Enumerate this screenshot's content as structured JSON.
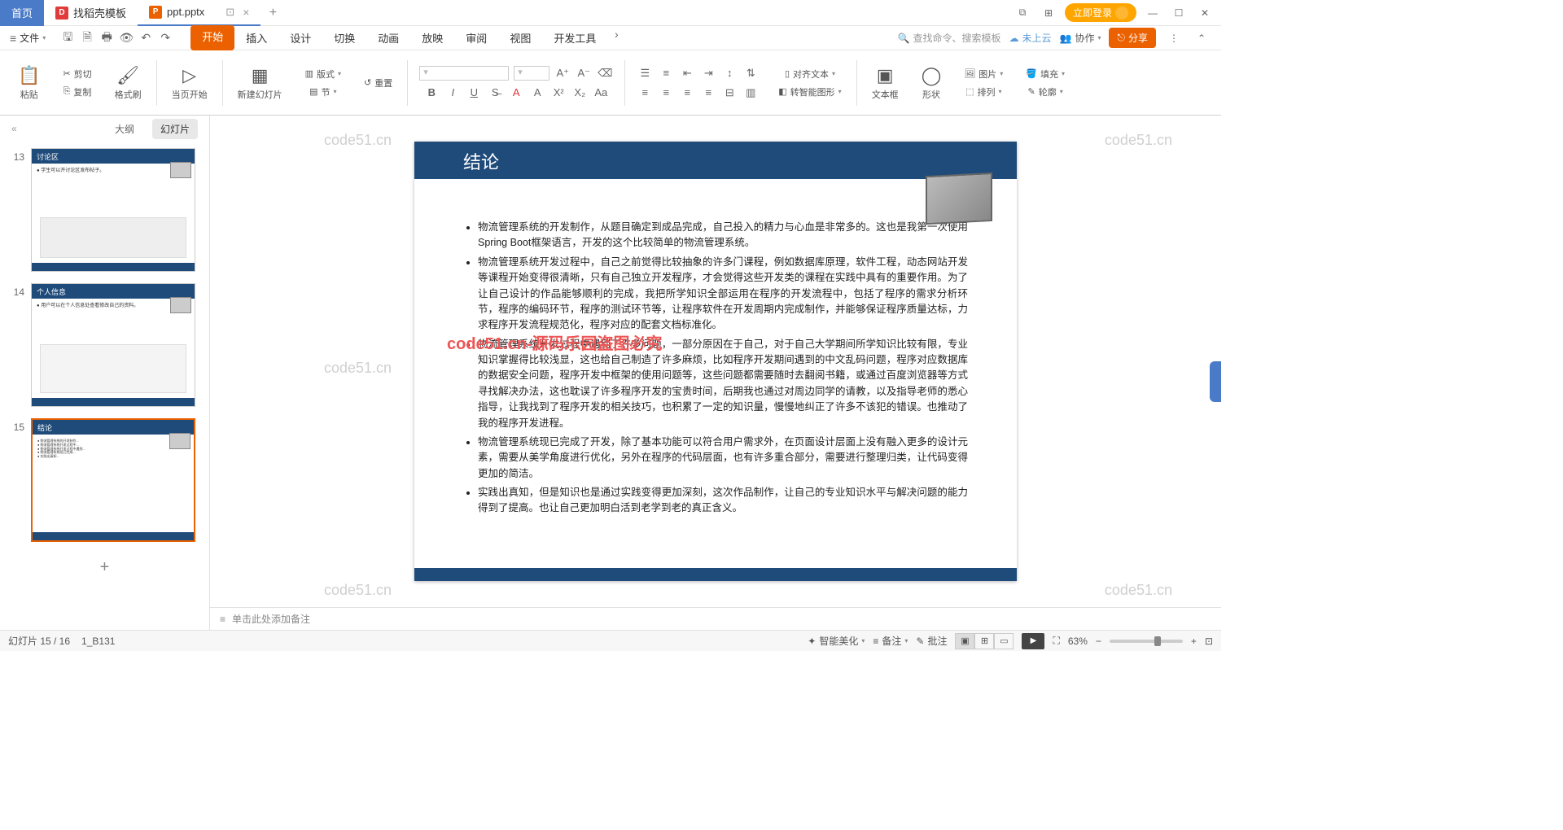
{
  "tabs": {
    "home": "首页",
    "t1": "找稻壳模板",
    "t2": "ppt.pptx"
  },
  "titlebar": {
    "login": "立即登录"
  },
  "menubar": {
    "file": "文件",
    "tabs": [
      "开始",
      "插入",
      "设计",
      "切换",
      "动画",
      "放映",
      "审阅",
      "视图",
      "开发工具"
    ],
    "search_placeholder": "查找命令、搜索模板",
    "cloud": "未上云",
    "coop": "协作",
    "share": "分享"
  },
  "ribbon": {
    "paste": "粘贴",
    "cut": "剪切",
    "copy": "复制",
    "format_painter": "格式刷",
    "from_current": "当页开始",
    "new_slide": "新建幻灯片",
    "layout": "版式",
    "section": "节",
    "reset": "重置",
    "align_text": "对齐文本",
    "smart_shape": "转智能图形",
    "textbox": "文本框",
    "shape": "形状",
    "picture": "图片",
    "arrange": "排列",
    "fill": "填充",
    "outline": "轮廓"
  },
  "side": {
    "outline": "大纲",
    "slides": "幻灯片"
  },
  "thumbs": [
    {
      "num": "13",
      "title": "讨论区",
      "line": "● 学生可以开讨论区发布帖子。"
    },
    {
      "num": "14",
      "title": "个人信息",
      "line": "● 用户可以在个人信息处查看修改自己的资料。"
    },
    {
      "num": "15",
      "title": "结论",
      "line": ""
    }
  ],
  "slide": {
    "title": "结论",
    "bullets": [
      "物流管理系统的开发制作，从题目确定到成品完成，自己投入的精力与心血是非常多的。这也是我第一次使用Spring Boot框架语言，开发的这个比较简单的物流管理系统。",
      "物流管理系统开发过程中，自己之前觉得比较抽象的许多门课程，例如数据库原理，软件工程，动态网站开发等课程开始变得很清晰，只有自己独立开发程序，才会觉得这些开发类的课程在实践中具有的重要作用。为了让自己设计的作品能够顺利的完成，我把所学知识全部运用在程序的开发流程中，包括了程序的需求分析环节，程序的编码环节，程序的测试环节等，让程序软件在开发周期内完成制作，并能够保证程序质量达标，力求程序开发流程规范化，程序对应的配套文档标准化。",
      "物流管理系统开发过程中遇到了许多问题，一部分原因在于自己，对于自己大学期间所学知识比较有限，专业知识掌握得比较浅显，这也给自己制造了许多麻烦，比如程序开发期间遇到的中文乱码问题，程序对应数据库的数据安全问题，程序开发中框架的使用问题等，这些问题都需要随时去翻阅书籍，或通过百度浏览器等方式寻找解决办法，这也耽误了许多程序开发的宝贵时间，后期我也通过对周边同学的请教，以及指导老师的悉心指导，让我找到了程序开发的相关技巧，也积累了一定的知识量，慢慢地纠正了许多不该犯的错误。也推动了我的程序开发进程。",
      "物流管理系统现已完成了开发，除了基本功能可以符合用户需求外，在页面设计层面上没有融入更多的设计元素，需要从美学角度进行优化，另外在程序的代码层面，也有许多重合部分，需要进行整理归类，让代码变得更加的简洁。",
      "实践出真知，但是知识也是通过实践变得更加深刻，这次作品制作，让自己的专业知识水平与解决问题的能力得到了提高。也让自己更加明白活到老学到老的真正含义。"
    ]
  },
  "watermarks": {
    "grey": "code51.cn",
    "red": "code51.cn-源码乐园盗图必究"
  },
  "notes": "单击此处添加备注",
  "status": {
    "slide_info": "幻灯片 15 / 16",
    "theme": "1_B131",
    "beautify": "智能美化",
    "notes_btn": "备注",
    "comment": "批注",
    "zoom": "63%"
  }
}
